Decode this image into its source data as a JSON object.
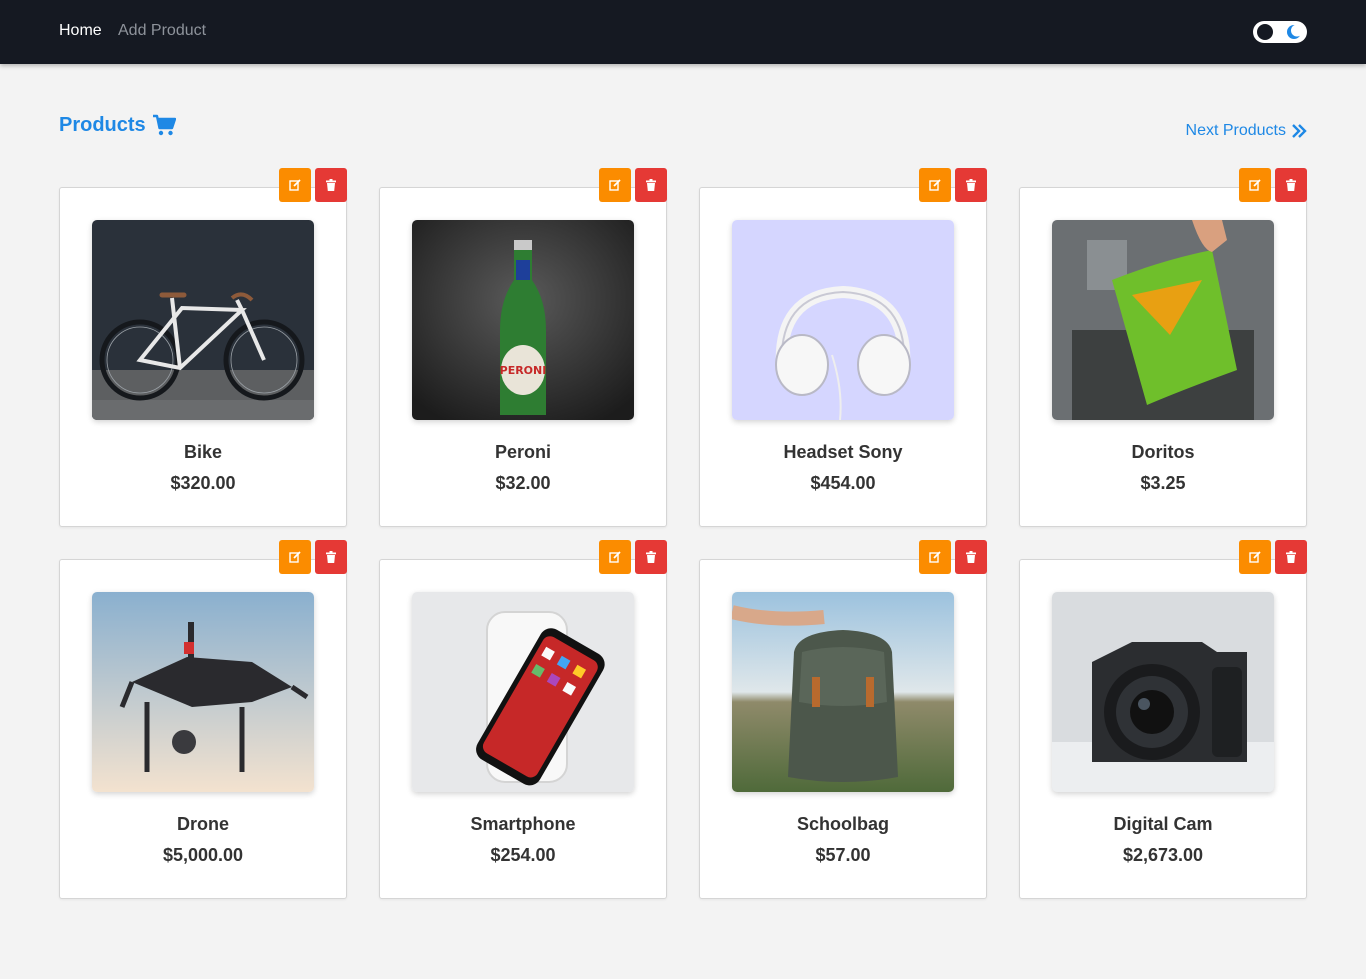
{
  "nav": {
    "home_label": "Home",
    "add_label": "Add Product"
  },
  "page": {
    "title": "Products",
    "next_label": "Next Products"
  },
  "products": [
    {
      "name": "Bike",
      "price": "$320.00"
    },
    {
      "name": "Peroni",
      "price": "$32.00"
    },
    {
      "name": "Headset Sony",
      "price": "$454.00"
    },
    {
      "name": "Doritos",
      "price": "$3.25"
    },
    {
      "name": "Drone",
      "price": "$5,000.00"
    },
    {
      "name": "Smartphone",
      "price": "$254.00"
    },
    {
      "name": "Schoolbag",
      "price": "$57.00"
    },
    {
      "name": "Digital Cam",
      "price": "$2,673.00"
    }
  ],
  "icons": {
    "cart": "cart-icon",
    "next": "double-chevron-right-icon",
    "edit": "edit-icon",
    "delete": "trash-icon",
    "theme": "moon-icon"
  },
  "colors": {
    "navbar": "#151922",
    "accent": "#1e88e5",
    "edit": "#fb8c00",
    "delete": "#e53935",
    "background": "#f3f3f3"
  }
}
